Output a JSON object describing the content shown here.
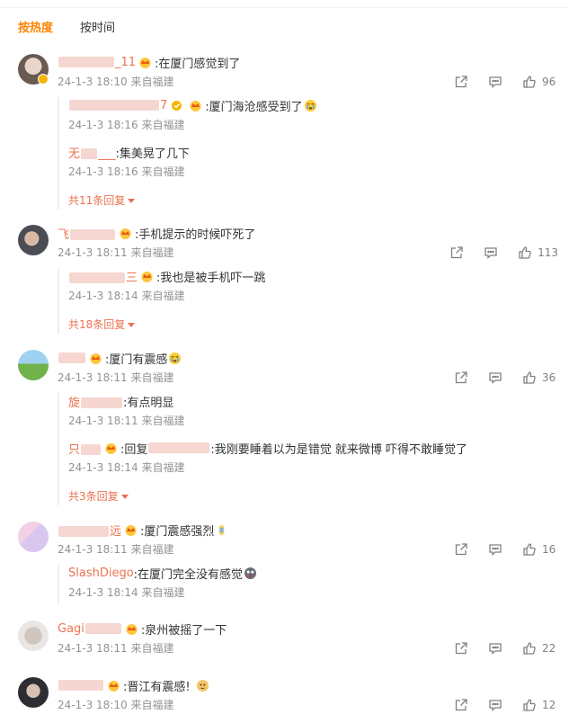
{
  "tabs": {
    "hot": "按热度",
    "time": "按时间"
  },
  "comments": [
    {
      "user_suffix": "_11",
      "text": ":在厦门感觉到了",
      "time": "24-1-3 18:10",
      "source": "来自福建",
      "likes": "96",
      "replies": [
        {
          "user_suffix": "7",
          "text": ":厦门海沧感受到了",
          "time": "24-1-3 18:16",
          "source": "来自福建"
        },
        {
          "user_prefix": "无",
          "user_suffix": "___",
          "text": ":集美晃了几下",
          "time": "24-1-3 18:16",
          "source": "来自福建"
        }
      ],
      "more": "共11条回复"
    },
    {
      "user_prefix": "飞",
      "text": ":手机提示的时候吓死了",
      "time": "24-1-3 18:11",
      "source": "来自福建",
      "likes": "113",
      "replies": [
        {
          "user_suffix": "三",
          "text": ":我也是被手机吓一跳",
          "time": "24-1-3 18:14",
          "source": "来自福建"
        }
      ],
      "more": "共18条回复"
    },
    {
      "text": ":厦门有震感",
      "time": "24-1-3 18:11",
      "source": "来自福建",
      "likes": "36",
      "replies": [
        {
          "user_prefix": "旋",
          "text": ":有点明显",
          "time": "24-1-3 18:11",
          "source": "来自福建"
        },
        {
          "user_prefix": "只",
          "text": ":回复",
          "text2": ":我刚要睡着以为是错觉 就来微博 吓得不敢睡觉了",
          "time": "24-1-3 18:14",
          "source": "来自福建"
        }
      ],
      "more": "共3条回复"
    },
    {
      "user_suffix": "远",
      "text": ":厦门震感强烈",
      "time": "24-1-3 18:11",
      "source": "来自福建",
      "likes": "16",
      "replies": [
        {
          "user_name": "SlashDiego",
          "text": ":在厦门完全没有感觉",
          "time": "24-1-3 18:14",
          "source": "来自福建"
        }
      ]
    },
    {
      "user_prefix": "Gagi",
      "text": ":泉州被摇了一下",
      "time": "24-1-3 18:11",
      "source": "来自福建",
      "likes": "22"
    },
    {
      "text": ":晋江有震感!",
      "time": "24-1-3 18:10",
      "source": "来自福建",
      "likes": "12"
    }
  ]
}
